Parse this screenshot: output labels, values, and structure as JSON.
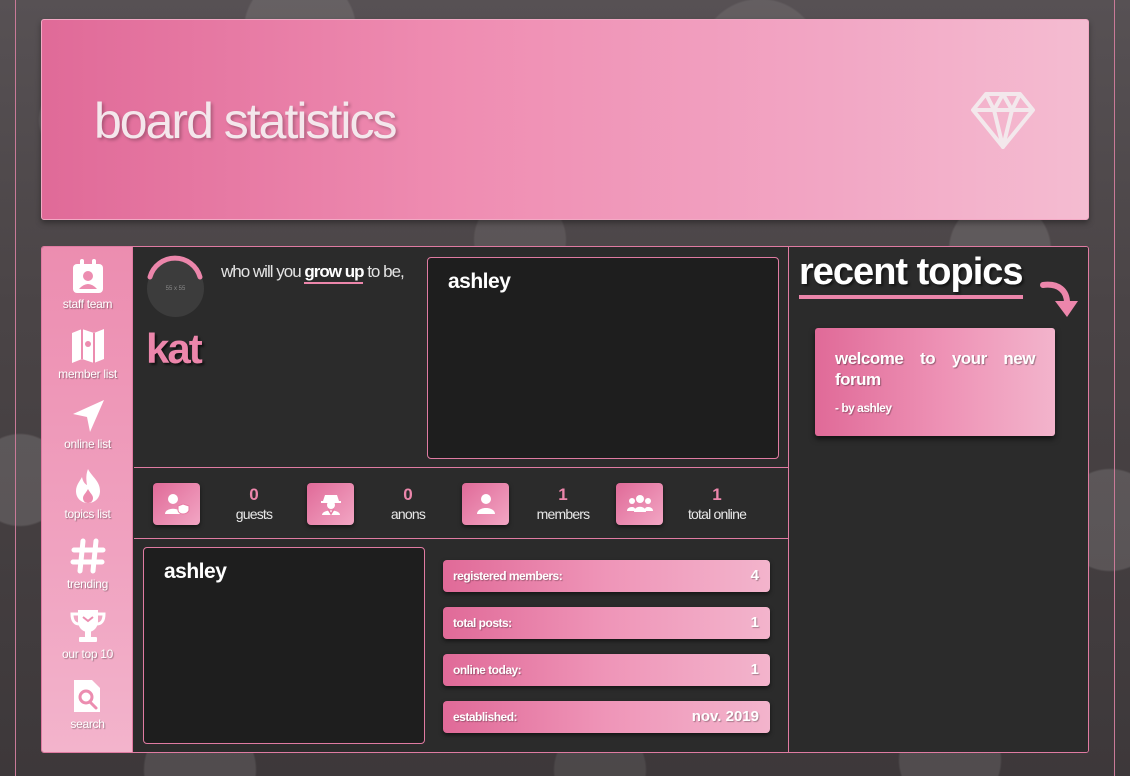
{
  "banner": {
    "title": "board statistics",
    "icon": "diamond-icon"
  },
  "sidebar": {
    "items": [
      {
        "label": "staff team",
        "icon": "badge-icon"
      },
      {
        "label": "member list",
        "icon": "map-icon"
      },
      {
        "label": "online list",
        "icon": "location-arrow-icon"
      },
      {
        "label": "topics list",
        "icon": "fire-icon"
      },
      {
        "label": "trending",
        "icon": "hashtag-icon"
      },
      {
        "label": "our top 10",
        "icon": "trophy-icon"
      },
      {
        "label": "search",
        "icon": "search-file-icon"
      }
    ]
  },
  "profile": {
    "avatar_text": "55 x 55",
    "tagline_pre": "who will you ",
    "tagline_bold": "grow up",
    "tagline_post": " to be,",
    "name": "kat",
    "about_name": "ashley"
  },
  "online": [
    {
      "count": "0",
      "label": "guests",
      "icon": "user-shield-icon"
    },
    {
      "count": "0",
      "label": "anons",
      "icon": "user-secret-icon"
    },
    {
      "count": "1",
      "label": "members",
      "icon": "user-icon"
    },
    {
      "count": "1",
      "label": "total online",
      "icon": "users-icon"
    }
  ],
  "latest_member": {
    "name": "ashley"
  },
  "stats": [
    {
      "label": "registered members:",
      "value": "4"
    },
    {
      "label": "total posts:",
      "value": "1"
    },
    {
      "label": "online today:",
      "value": "1"
    },
    {
      "label": "established:",
      "value": "nov. 2019"
    }
  ],
  "recent": {
    "title": "recent topics",
    "topics": [
      {
        "title": "welcome to your new forum",
        "by": "- by ashley"
      }
    ]
  },
  "colors": {
    "accent": "#ec86ab",
    "panel": "#2b2b2b",
    "box": "#1e1e1e"
  }
}
